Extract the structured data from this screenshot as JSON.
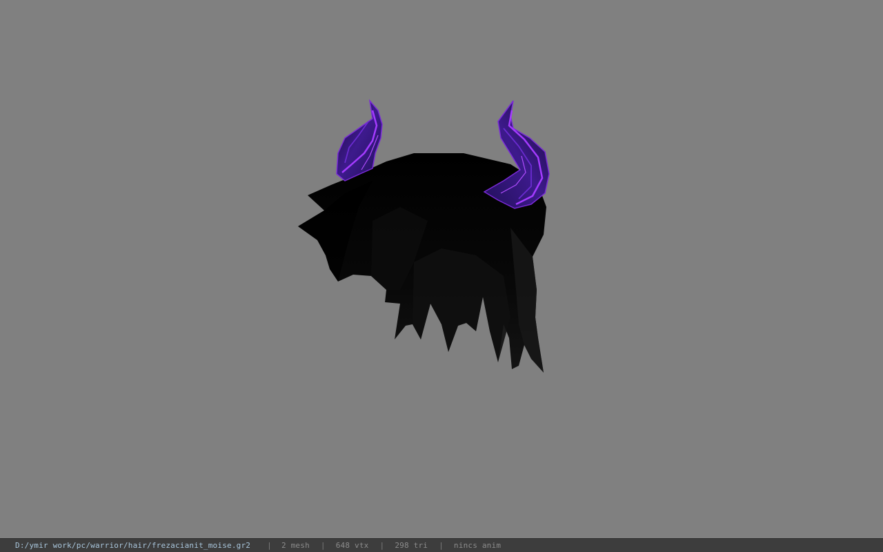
{
  "viewport": {
    "background_color": "#808080",
    "model": {
      "hair_color": "#050505",
      "horn_color": "#3a1470",
      "horn_highlight_color": "#9a2cf0"
    }
  },
  "status_bar": {
    "file_path": "D:/ymir work/pc/warrior/hair/frezacianit_moise.gr2",
    "separator": "|",
    "mesh_count": "2 mesh",
    "vertex_count": "648 vtx",
    "triangle_count": "298 tri",
    "animation": "nincs anim"
  }
}
